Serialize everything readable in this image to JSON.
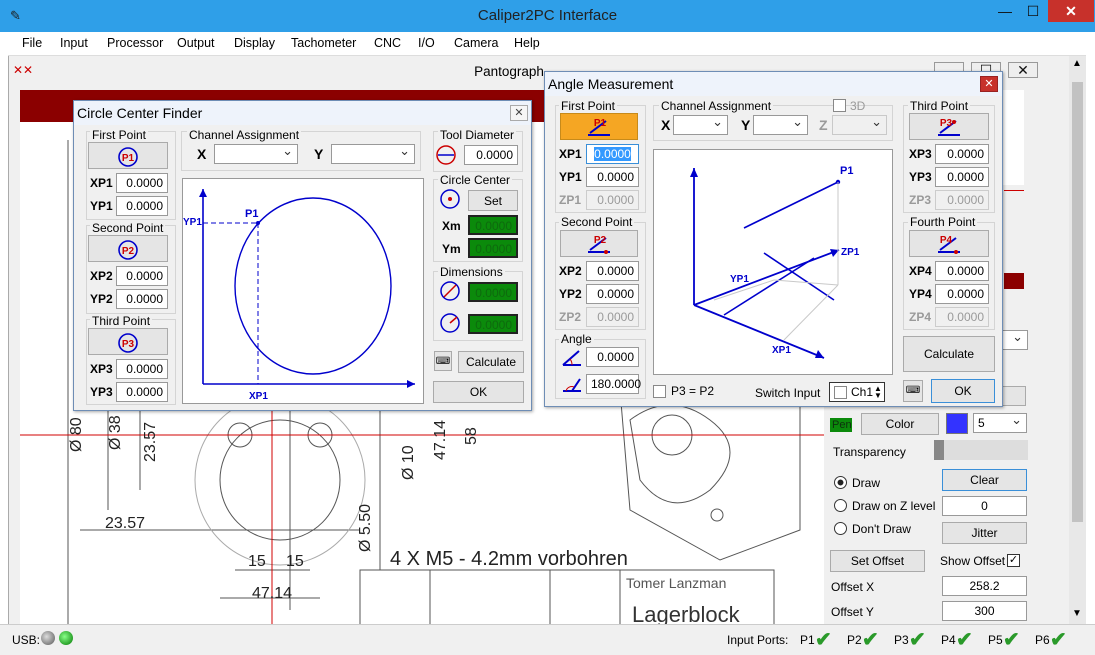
{
  "app": {
    "title": "Caliper2PC Interface"
  },
  "menu": [
    "File",
    "Input",
    "Processor",
    "Output",
    "Display",
    "Tachometer",
    "CNC",
    "I/O",
    "Camera",
    "Help"
  ],
  "pantograph": {
    "title": "Pantograph"
  },
  "drawing": {
    "note": "4 X M5 - 4.2mm vorbohren",
    "author": "Tomer Lanzman",
    "part": "Lagerblock",
    "dims": [
      "Ø 80",
      "Ø 38",
      "23.57",
      "Ø 10",
      "47.14",
      "58",
      "Ø 5.50",
      "23.57",
      "15",
      "15",
      "47.14"
    ]
  },
  "ccf": {
    "title": "Circle Center Finder",
    "first_point": "First Point",
    "second_point": "Second Point",
    "third_point": "Third Point",
    "xp1": "XP1",
    "yp1": "YP1",
    "xp2": "XP2",
    "yp2": "YP2",
    "xp3": "XP3",
    "yp3": "YP3",
    "xp1_val": "0.0000",
    "yp1_val": "0.0000",
    "xp2_val": "0.0000",
    "yp2_val": "0.0000",
    "xp3_val": "0.0000",
    "yp3_val": "0.0000",
    "channel": "Channel Assignment",
    "x": "X",
    "y": "Y",
    "tool_diameter": "Tool Diameter",
    "tool_val": "0.0000",
    "circle_center": "Circle Center",
    "set": "Set",
    "xm": "Xm",
    "ym": "Ym",
    "xm_val": "0.0000",
    "ym_val": "0.0000",
    "dimensions": "Dimensions",
    "d_val": "0.0000",
    "r_val": "0.0000",
    "calculate": "Calculate",
    "ok": "OK",
    "p1": "P1",
    "p2": "P2",
    "p3": "P3",
    "diag_p1": "P1",
    "diag_yp1": "YP1",
    "diag_xp1": "XP1"
  },
  "am": {
    "title": "Angle Measurement",
    "first_point": "First Point",
    "second_point": "Second Point",
    "third_point": "Third Point",
    "fourth_point": "Fourth Point",
    "xp1": "XP1",
    "yp1": "YP1",
    "zp1": "ZP1",
    "xp2": "XP2",
    "yp2": "YP2",
    "zp2": "ZP2",
    "xp3": "XP3",
    "yp3": "YP3",
    "zp3": "ZP3",
    "xp4": "XP4",
    "yp4": "YP4",
    "zp4": "ZP4",
    "xp1_val": "0.0000",
    "yp1_val": "0.0000",
    "zp1_val": "0.0000",
    "xp2_val": "0.0000",
    "yp2_val": "0.0000",
    "zp2_val": "0.0000",
    "xp3_val": "0.0000",
    "yp3_val": "0.0000",
    "zp3_val": "0.0000",
    "xp4_val": "0.0000",
    "yp4_val": "0.0000",
    "zp4_val": "0.0000",
    "channel": "Channel Assignment",
    "x": "X",
    "y": "Y",
    "z": "Z",
    "three_d": "3D",
    "angle": "Angle",
    "angle_val": "0.0000",
    "angle2_val": "180.0000",
    "p3p2": "P3 = P2",
    "switch_input": "Switch Input",
    "ch1": "Ch1",
    "calculate": "Calculate",
    "ok": "OK",
    "p1": "P1",
    "p2": "P2",
    "p3": "P3",
    "p4": "P4",
    "ax_p1": "P1",
    "ax_zp1": "ZP1",
    "ax_yp1": "YP1",
    "ax_xp1": "XP1"
  },
  "right": {
    "pen": "Pen",
    "color": "Color",
    "pen_size": "5",
    "transparency": "Transparency",
    "draw": "Draw",
    "draw_z": "Draw on Z level",
    "dont_draw": "Don't Draw",
    "clear": "Clear",
    "z_val": "0",
    "jitter": "Jitter",
    "set_offset": "Set Offset",
    "show_offset": "Show Offset",
    "offset_x": "Offset X",
    "offset_x_val": "258.2",
    "offset_y": "Offset Y",
    "offset_y_val": "300",
    "accent": "#3333ff"
  },
  "status": {
    "usb": "USB:",
    "input_ports": "Input Ports:",
    "ports": [
      "P1",
      "P2",
      "P3",
      "P4",
      "P5",
      "P6"
    ]
  },
  "colors": {
    "titlebar": "#2f9fe8",
    "highlight": "#f5a623",
    "green": "#0b8a0b",
    "blue": "#0000cc"
  }
}
